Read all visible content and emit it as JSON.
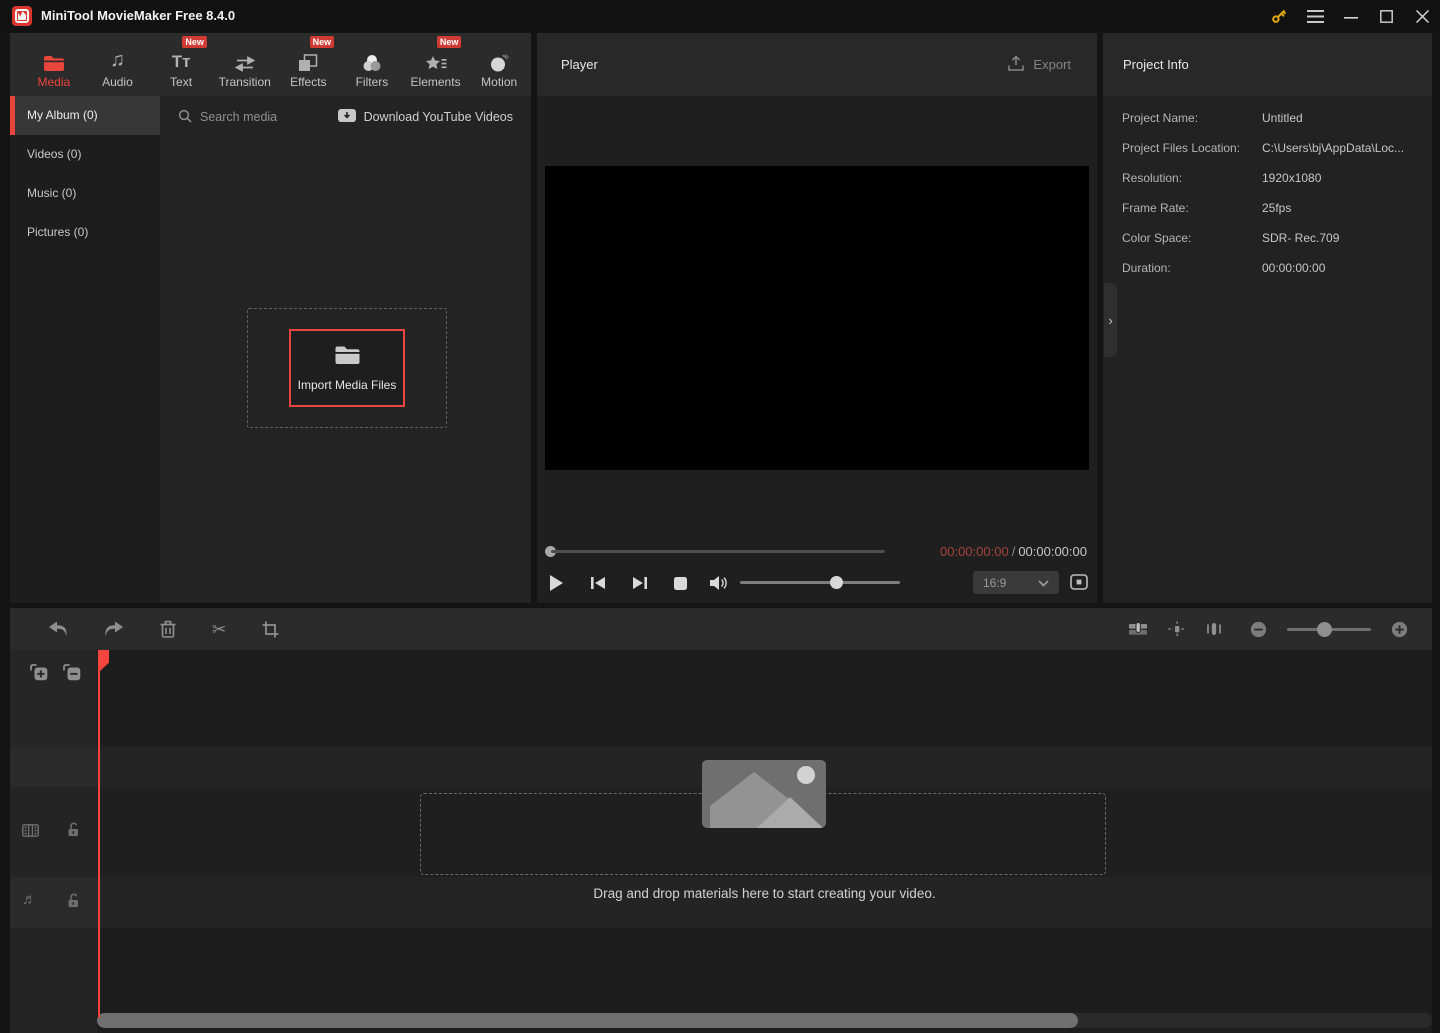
{
  "window": {
    "title": "MiniTool MovieMaker Free 8.4.0"
  },
  "ribbon": {
    "tabs": [
      {
        "label": "Media",
        "badge": "",
        "active": true
      },
      {
        "label": "Audio",
        "badge": "",
        "active": false
      },
      {
        "label": "Text",
        "badge": "New",
        "active": false
      },
      {
        "label": "Transition",
        "badge": "",
        "active": false
      },
      {
        "label": "Effects",
        "badge": "New",
        "active": false
      },
      {
        "label": "Filters",
        "badge": "",
        "active": false
      },
      {
        "label": "Elements",
        "badge": "New",
        "active": false
      },
      {
        "label": "Motion",
        "badge": "",
        "active": false
      }
    ]
  },
  "media_panel": {
    "sidebar_items": [
      {
        "label": "My Album (0)",
        "active": true
      },
      {
        "label": "Videos (0)",
        "active": false
      },
      {
        "label": "Music (0)",
        "active": false
      },
      {
        "label": "Pictures (0)",
        "active": false
      }
    ],
    "search_placeholder": "Search media",
    "youtube_label": "Download YouTube Videos",
    "import_label": "Import Media Files"
  },
  "player": {
    "title": "Player",
    "export_label": "Export",
    "current_time": "00:00:00:00",
    "time_separator": "/",
    "total_time": "00:00:00:00",
    "aspect_ratio": "16:9"
  },
  "project_info": {
    "title": "Project Info",
    "rows": [
      {
        "label": "Project Name:",
        "value": "Untitled"
      },
      {
        "label": "Project Files Location:",
        "value": "C:\\Users\\bj\\AppData\\Loc..."
      },
      {
        "label": "Resolution:",
        "value": "1920x1080"
      },
      {
        "label": "Frame Rate:",
        "value": "25fps"
      },
      {
        "label": "Color Space:",
        "value": "SDR- Rec.709"
      },
      {
        "label": "Duration:",
        "value": "00:00:00:00"
      }
    ]
  },
  "timeline": {
    "hint": "Drag and drop materials here to start creating your video."
  },
  "icons": {
    "scissors": "✂",
    "chevron_right": "›",
    "audio_note": "♫",
    "track_note": "♬",
    "text_tool": "Tт"
  },
  "colors": {
    "accent_red": "#e8453c",
    "badge_red": "#cf3b34",
    "playhead_red": "#f4453e",
    "key_yellow": "#e3a912",
    "time_current_red": "#a5443c",
    "panel_dark": "#232323",
    "toolbar_gray": "#2b2b2b"
  }
}
